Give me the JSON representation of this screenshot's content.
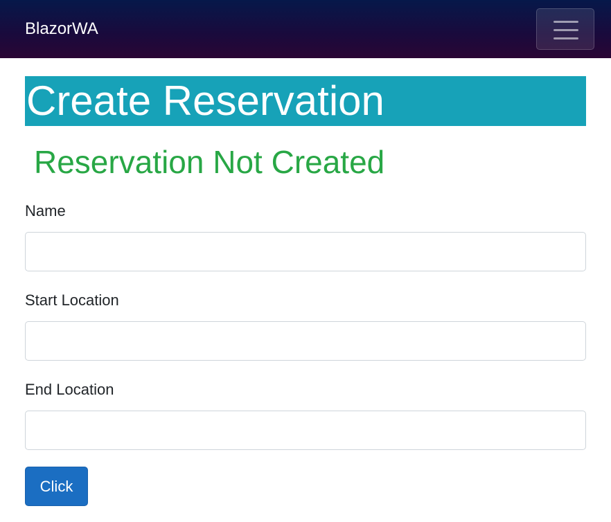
{
  "navbar": {
    "brand": "BlazorWA",
    "toggler_icon": "hamburger-menu-icon"
  },
  "page": {
    "title": "Create Reservation",
    "status": "Reservation Not Created",
    "status_color": "#28a745",
    "title_background": "#17a2b8"
  },
  "form": {
    "name": {
      "label": "Name",
      "value": ""
    },
    "start_location": {
      "label": "Start Location",
      "value": ""
    },
    "end_location": {
      "label": "End Location",
      "value": ""
    },
    "submit_label": "Click"
  },
  "colors": {
    "button": "#1b6ec2",
    "navbar_top": "#06184a",
    "navbar_bottom": "#2a0634"
  }
}
